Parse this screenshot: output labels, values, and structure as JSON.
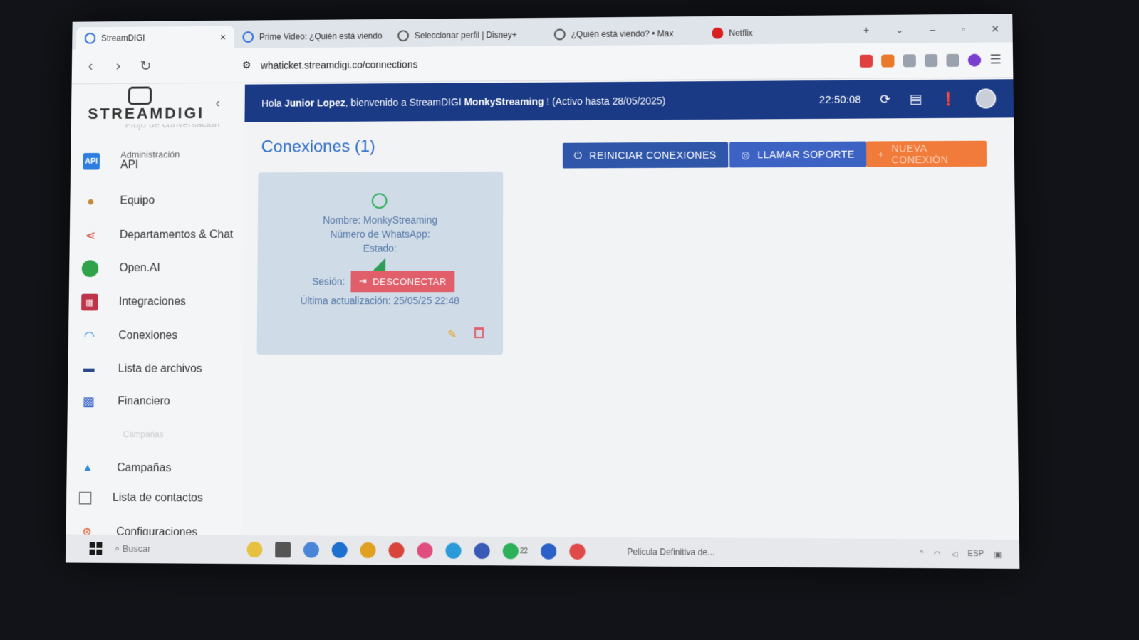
{
  "browser": {
    "tabs": [
      {
        "label": "StreamDIGI",
        "active": true,
        "close": "×"
      },
      {
        "label": "Prime Video: ¿Quién está viendo"
      },
      {
        "label": "Seleccionar perfil | Disney+"
      },
      {
        "label": "¿Quién está viendo? • Max"
      },
      {
        "label": "Netflix"
      }
    ],
    "new_tab": "+",
    "url": "whaticket.streamdigi.co/connections"
  },
  "sidebar": {
    "brand": "STREAMDIGI",
    "collapse": "‹",
    "partial_item": "Flujo de conversación",
    "api": {
      "small": "Administración",
      "label": "API",
      "icon_text": "API"
    },
    "items": [
      {
        "label": "Equipo",
        "icon": "person-icon"
      },
      {
        "label": "Departamentos & Chat",
        "icon": "share-icon"
      },
      {
        "label": "Open.AI",
        "icon": "openai-icon"
      },
      {
        "label": "Integraciones",
        "icon": "grid-icon"
      },
      {
        "label": "Conexiones",
        "icon": "wifi-icon"
      },
      {
        "label": "Lista de archivos",
        "icon": "files-icon"
      },
      {
        "label": "Financiero",
        "icon": "qr-icon"
      },
      {
        "label": "Campañas",
        "icon": "campaign-icon"
      },
      {
        "label": "Lista de contactos",
        "icon": "contacts-icon"
      },
      {
        "label": "Configuraciones",
        "icon": "settings-icon"
      }
    ],
    "section_label": "Campañas"
  },
  "topbar": {
    "greet_prefix": "Hola ",
    "user": "Junior Lopez",
    "greet_mid": ", bienvenido a StreamDIGI ",
    "company": "MonkyStreaming",
    "greet_suffix": " ! (Activo hasta 28/05/2025)",
    "clock": "22:50:08"
  },
  "main": {
    "title": "Conexiones (1)",
    "buttons": {
      "restart": "REINICIAR CONEXIONES",
      "support": "LLAMAR SOPORTE",
      "new": "NUEVA CONEXIÓN"
    },
    "card": {
      "name": "Nombre: MonkyStreaming",
      "number": "Número de WhatsApp:",
      "state": "Estado:",
      "session_label": "Sesión:",
      "disconnect": "DESCONECTAR",
      "updated": "Última actualización: 25/05/25 22:48"
    }
  },
  "taskbar": {
    "search": "Buscar",
    "media": "Pelicula Definitiva de...",
    "lang": "ESP",
    "whatsapp_badge": "22"
  },
  "colors": {
    "topbar": "#1b3a86",
    "title": "#2b6cc4",
    "card": "#cfdbe6",
    "disconnect": "#e05f6a",
    "new_conn": "#f07b3b"
  }
}
